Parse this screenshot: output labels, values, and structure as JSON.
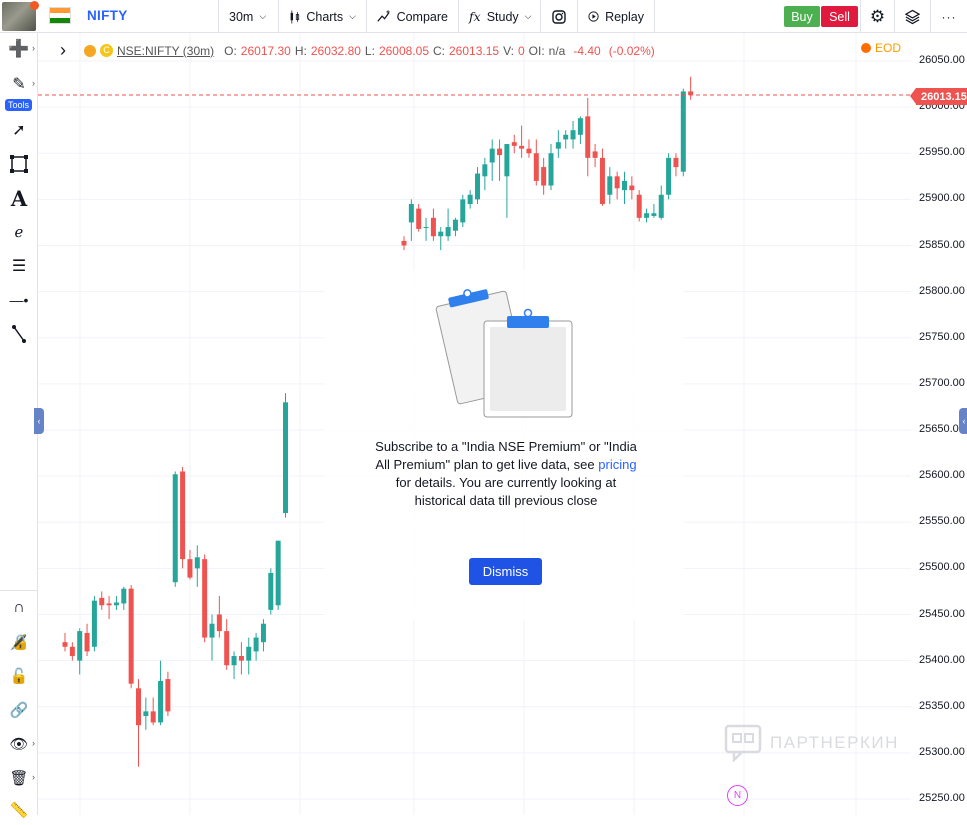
{
  "header": {
    "symbol": "NIFTY",
    "interval": "30m",
    "charts_label": "Charts",
    "compare_label": "Compare",
    "study_label": "Study",
    "replay_label": "Replay",
    "buy_label": "Buy",
    "sell_label": "Sell"
  },
  "sidebar": {
    "tools_badge": "Tools"
  },
  "legend": {
    "symbol_line": "NSE:NIFTY (30m)",
    "open_label": "O:",
    "open": "26017.30",
    "high_label": "H:",
    "high": "26032.80",
    "low_label": "L:",
    "low": "26008.05",
    "close_label": "C:",
    "close": "26013.15",
    "volume_label": "V:",
    "volume": "0",
    "oi_label": "OI:",
    "oi": "n/a",
    "change": "-4.40",
    "change_pct": "(-0.02%)",
    "eod": "EOD"
  },
  "price_axis": {
    "ticks": [
      "26050.00",
      "26000.00",
      "25950.00",
      "25900.00",
      "25850.00",
      "25800.00",
      "25750.00",
      "25700.00",
      "25650.00",
      "25600.00",
      "25550.00",
      "25500.00",
      "25450.00",
      "25400.00",
      "25350.00",
      "25300.00",
      "25250.00"
    ],
    "last_price": "26013.15"
  },
  "notice": {
    "line_prefix": "Subscribe to a \"India NSE Premium\" or \"India All Premium\" plan to get live data, see ",
    "link": "pricing",
    "line_suffix": " for details. You are currently looking at historical data till previous close",
    "dismiss_label": "Dismiss"
  },
  "watermark": "ПАРТНЕРКИН",
  "n_badge": "N",
  "colors": {
    "up": "#26a69a",
    "down": "#ef5350",
    "accent": "#2962ff",
    "buy": "#4caf50",
    "sell": "#e0193e"
  },
  "chart_data": {
    "type": "candlestick",
    "price_range": [
      25240,
      26070
    ],
    "candles": [
      {
        "o": 25420,
        "h": 25430,
        "l": 25410,
        "c": 25415
      },
      {
        "o": 25415,
        "h": 25420,
        "l": 25400,
        "c": 25405
      },
      {
        "o": 25400,
        "h": 25435,
        "l": 25385,
        "c": 25432
      },
      {
        "o": 25430,
        "h": 25440,
        "l": 25405,
        "c": 25410
      },
      {
        "o": 25415,
        "h": 25470,
        "l": 25410,
        "c": 25465
      },
      {
        "o": 25468,
        "h": 25475,
        "l": 25455,
        "c": 25460
      },
      {
        "o": 25462,
        "h": 25470,
        "l": 25445,
        "c": 25460
      },
      {
        "o": 25460,
        "h": 25470,
        "l": 25455,
        "c": 25463
      },
      {
        "o": 25462,
        "h": 25480,
        "l": 25455,
        "c": 25478
      },
      {
        "o": 25478,
        "h": 25482,
        "l": 25370,
        "c": 25375
      },
      {
        "o": 25370,
        "h": 25380,
        "l": 25285,
        "c": 25330
      },
      {
        "o": 25340,
        "h": 25360,
        "l": 25325,
        "c": 25345
      },
      {
        "o": 25345,
        "h": 25360,
        "l": 25330,
        "c": 25333
      },
      {
        "o": 25333,
        "h": 25400,
        "l": 25330,
        "c": 25378
      },
      {
        "o": 25380,
        "h": 25388,
        "l": 25340,
        "c": 25345
      },
      {
        "o": 25485,
        "h": 25605,
        "l": 25480,
        "c": 25602
      },
      {
        "o": 25605,
        "h": 25610,
        "l": 25500,
        "c": 25510
      },
      {
        "o": 25510,
        "h": 25520,
        "l": 25488,
        "c": 25490
      },
      {
        "o": 25500,
        "h": 25525,
        "l": 25480,
        "c": 25512
      },
      {
        "o": 25510,
        "h": 25515,
        "l": 25420,
        "c": 25425
      },
      {
        "o": 25425,
        "h": 25450,
        "l": 25400,
        "c": 25440
      },
      {
        "o": 25450,
        "h": 25470,
        "l": 25425,
        "c": 25432
      },
      {
        "o": 25432,
        "h": 25445,
        "l": 25390,
        "c": 25395
      },
      {
        "o": 25395,
        "h": 25410,
        "l": 25380,
        "c": 25405
      },
      {
        "o": 25405,
        "h": 25420,
        "l": 25385,
        "c": 25400
      },
      {
        "o": 25400,
        "h": 25425,
        "l": 25385,
        "c": 25415
      },
      {
        "o": 25410,
        "h": 25430,
        "l": 25400,
        "c": 25425
      },
      {
        "o": 25420,
        "h": 25445,
        "l": 25410,
        "c": 25440
      },
      {
        "o": 25455,
        "h": 25500,
        "l": 25450,
        "c": 25495
      },
      {
        "o": 25460,
        "h": 25530,
        "l": 25455,
        "c": 25530
      },
      {
        "o": 25560,
        "h": 25690,
        "l": 25555,
        "c": 25680
      },
      {
        "o": 25855,
        "h": 25860,
        "l": 25845,
        "c": 25850
      },
      {
        "o": 25875,
        "h": 25900,
        "l": 25855,
        "c": 25895
      },
      {
        "o": 25890,
        "h": 25895,
        "l": 25865,
        "c": 25868
      },
      {
        "o": 25870,
        "h": 25880,
        "l": 25855,
        "c": 25870
      },
      {
        "o": 25880,
        "h": 25890,
        "l": 25855,
        "c": 25860
      },
      {
        "o": 25860,
        "h": 25870,
        "l": 25845,
        "c": 25865
      },
      {
        "o": 25860,
        "h": 25890,
        "l": 25855,
        "c": 25870
      },
      {
        "o": 25866,
        "h": 25880,
        "l": 25860,
        "c": 25878
      },
      {
        "o": 25875,
        "h": 25905,
        "l": 25870,
        "c": 25900
      },
      {
        "o": 25895,
        "h": 25910,
        "l": 25890,
        "c": 25905
      },
      {
        "o": 25900,
        "h": 25935,
        "l": 25895,
        "c": 25928
      },
      {
        "o": 25925,
        "h": 25945,
        "l": 25910,
        "c": 25938
      },
      {
        "o": 25940,
        "h": 25965,
        "l": 25920,
        "c": 25955
      },
      {
        "o": 25955,
        "h": 25965,
        "l": 25920,
        "c": 25948
      },
      {
        "o": 25925,
        "h": 25960,
        "l": 25880,
        "c": 25960
      },
      {
        "o": 25962,
        "h": 25970,
        "l": 25950,
        "c": 25958
      },
      {
        "o": 25958,
        "h": 25980,
        "l": 25945,
        "c": 25955
      },
      {
        "o": 25955,
        "h": 25965,
        "l": 25945,
        "c": 25950
      },
      {
        "o": 25950,
        "h": 25965,
        "l": 25915,
        "c": 25920
      },
      {
        "o": 25935,
        "h": 25945,
        "l": 25905,
        "c": 25915
      },
      {
        "o": 25915,
        "h": 25960,
        "l": 25910,
        "c": 25950
      },
      {
        "o": 25955,
        "h": 25975,
        "l": 25945,
        "c": 25962
      },
      {
        "o": 25965,
        "h": 25975,
        "l": 25955,
        "c": 25970
      },
      {
        "o": 25965,
        "h": 25985,
        "l": 25955,
        "c": 25975
      },
      {
        "o": 25970,
        "h": 25990,
        "l": 25960,
        "c": 25988
      },
      {
        "o": 25990,
        "h": 26010,
        "l": 25925,
        "c": 25945
      },
      {
        "o": 25952,
        "h": 25960,
        "l": 25935,
        "c": 25945
      },
      {
        "o": 25945,
        "h": 25955,
        "l": 25893,
        "c": 25895
      },
      {
        "o": 25905,
        "h": 25935,
        "l": 25895,
        "c": 25925
      },
      {
        "o": 25925,
        "h": 25930,
        "l": 25900,
        "c": 25912
      },
      {
        "o": 25910,
        "h": 25930,
        "l": 25895,
        "c": 25920
      },
      {
        "o": 25915,
        "h": 25925,
        "l": 25900,
        "c": 25910
      },
      {
        "o": 25905,
        "h": 25910,
        "l": 25876,
        "c": 25880
      },
      {
        "o": 25880,
        "h": 25890,
        "l": 25875,
        "c": 25885
      },
      {
        "o": 25882,
        "h": 25895,
        "l": 25880,
        "c": 25885
      },
      {
        "o": 25880,
        "h": 25915,
        "l": 25878,
        "c": 25905
      },
      {
        "o": 25905,
        "h": 25950,
        "l": 25900,
        "c": 25945
      },
      {
        "o": 25945,
        "h": 25950,
        "l": 25925,
        "c": 25935
      },
      {
        "o": 25930,
        "h": 26020,
        "l": 25925,
        "c": 26017
      },
      {
        "o": 26017,
        "h": 26033,
        "l": 26008,
        "c": 26013
      }
    ]
  }
}
